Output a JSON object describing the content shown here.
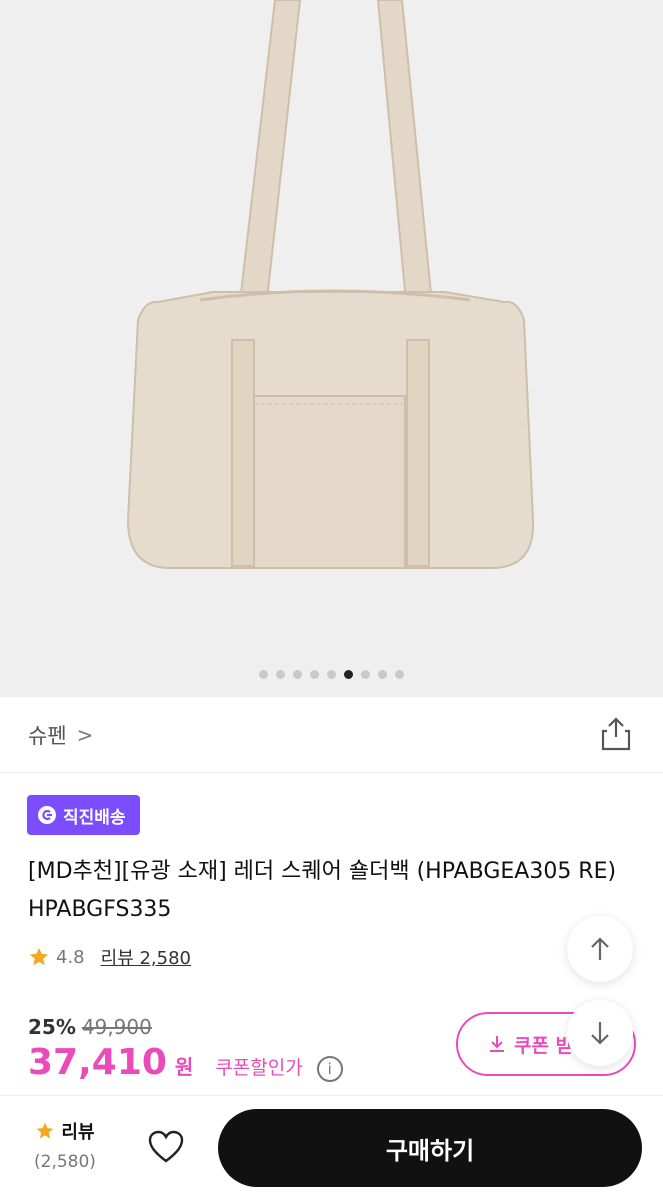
{
  "hero": {
    "image_label": "beige leather square shoulder bag",
    "dots_total": 9,
    "dots_active_index": 5
  },
  "brand": {
    "name": "슈펜",
    "chevron": ">",
    "share_icon": "share-icon"
  },
  "badge": {
    "label": "직진배송",
    "icon": "redirect-arrow-icon",
    "color": "#7b4dff"
  },
  "product": {
    "title": "[MD추천][유광 소재] 레더 스퀘어 숄더백 (HPABGEA305 RE) HPABGFS335"
  },
  "rating": {
    "score": "4.8",
    "review_label": "리뷰 2,580",
    "star_color": "#f5a623"
  },
  "price": {
    "discount": "25%",
    "original": "49,900",
    "current": "37,410",
    "currency": "원",
    "coupon_discount_label": "쿠폰할인가",
    "info_icon": "i",
    "accent": "#e94cba"
  },
  "coupon_button": {
    "label": "쿠폰 받"
  },
  "bottom_bar": {
    "review_label": "리뷰",
    "review_count": "(2,580)",
    "buy_label": "구매하기"
  }
}
